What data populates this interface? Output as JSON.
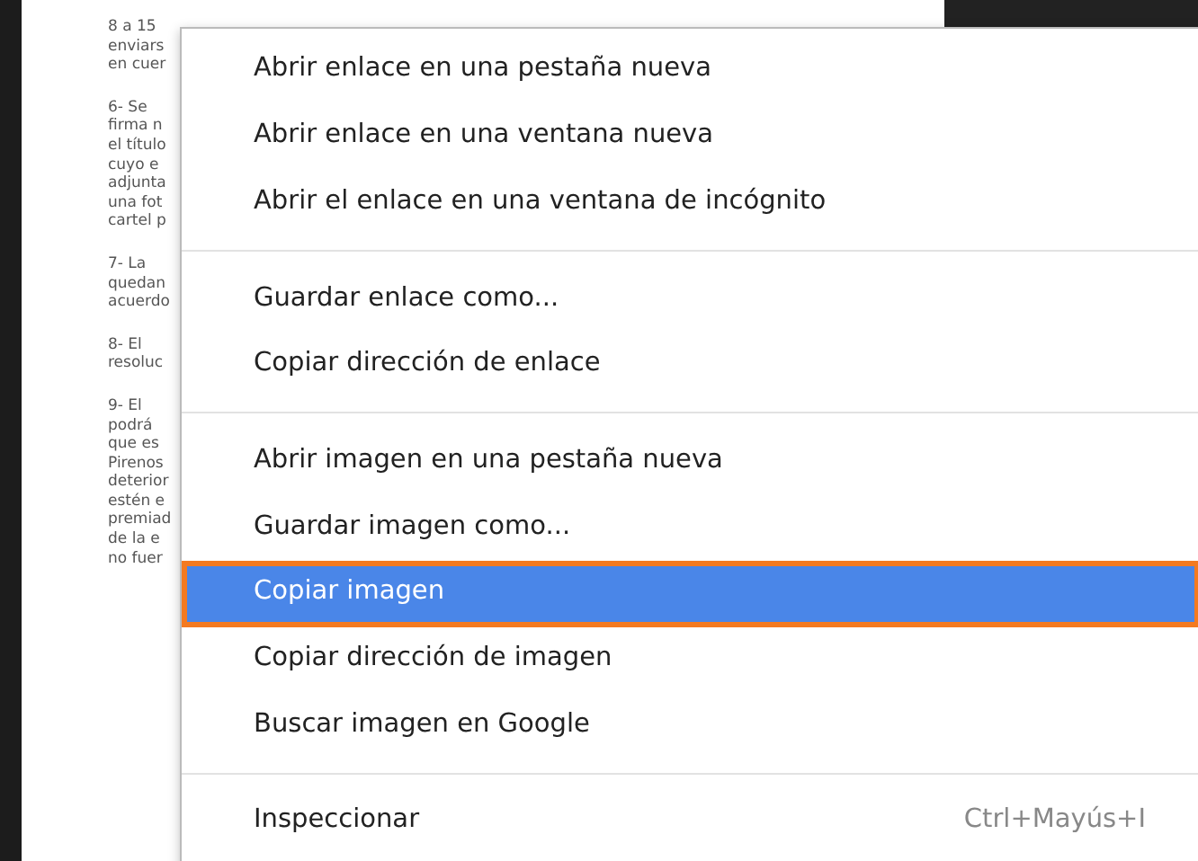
{
  "document": {
    "paragraphs": [
      {
        "lines": [
          "8 a 15",
          "enviars",
          "en cuer"
        ]
      },
      {
        "lines": [
          "6- Se",
          "firma n",
          "el título",
          "cuyo e",
          "adjunta",
          "una fot",
          "cartel p"
        ]
      },
      {
        "lines": [
          "7- La",
          "quedan",
          "acuerdo"
        ]
      },
      {
        "lines": [
          "8- El",
          "resoluc"
        ]
      },
      {
        "lines": [
          "9- El",
          "podrá",
          "que es",
          "Pirenos",
          "deterior",
          "estén e",
          "premiad",
          "de la e",
          "no fuer"
        ]
      }
    ]
  },
  "context_menu": {
    "groups": [
      {
        "items": [
          {
            "label": "Abrir enlace en una pestaña nueva",
            "selected": false
          },
          {
            "label": "Abrir enlace en una ventana nueva",
            "selected": false
          },
          {
            "label": "Abrir el enlace en una ventana de incógnito",
            "selected": false
          }
        ]
      },
      {
        "items": [
          {
            "label": "Guardar enlace como...",
            "selected": false
          },
          {
            "label": "Copiar dirección de enlace",
            "selected": false
          }
        ]
      },
      {
        "items": [
          {
            "label": "Abrir imagen en una pestaña nueva",
            "selected": false
          },
          {
            "label": "Guardar imagen como...",
            "selected": false
          },
          {
            "label": "Copiar imagen",
            "selected": true
          },
          {
            "label": "Copiar dirección de imagen",
            "selected": false
          },
          {
            "label": "Buscar imagen en Google",
            "selected": false
          }
        ]
      },
      {
        "items": [
          {
            "label": "Inspeccionar",
            "shortcut": "Ctrl+Mayús+I",
            "selected": false
          }
        ]
      }
    ]
  }
}
